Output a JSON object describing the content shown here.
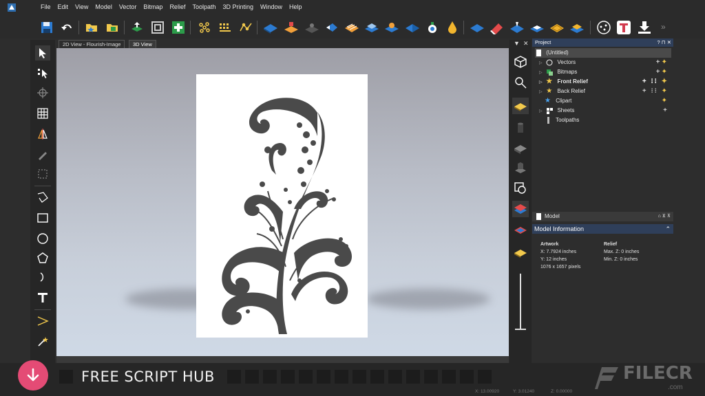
{
  "menubar": {
    "items": [
      "File",
      "Edit",
      "View",
      "Model",
      "Vector",
      "Bitmap",
      "Relief",
      "Toolpath",
      "3D Printing",
      "Window",
      "Help"
    ]
  },
  "tabs": [
    {
      "label": "2D View - Flourish-Image",
      "active": false
    },
    {
      "label": "3D View",
      "active": true
    }
  ],
  "project": {
    "title": "Project",
    "controls": "? ⊓ ✕",
    "pin": "✕",
    "root": "(Untitled)",
    "items": [
      {
        "label": "Vectors",
        "bold": false
      },
      {
        "label": "Bitmaps",
        "bold": false
      },
      {
        "label": "Front Relief",
        "bold": true
      },
      {
        "label": "Back Relief",
        "bold": false
      },
      {
        "label": "Clipart",
        "bold": false
      },
      {
        "label": "Sheets",
        "bold": false
      },
      {
        "label": "Toolpaths",
        "bold": false
      }
    ]
  },
  "model": {
    "header": "Model",
    "info_title": "Model Information",
    "artwork": {
      "heading": "Artwork",
      "x": "X: 7.7924 inches",
      "y": "Y: 12 inches",
      "pixels": "1076 x 1657 pixels"
    },
    "relief": {
      "heading": "Relief",
      "max_z": "Max. Z: 0 inches",
      "min_z": "Min. Z: 0 inches"
    }
  },
  "status": {
    "x": "X: 13.00920",
    "y": "Y: 3.01240",
    "z": "Z: 0.00000"
  },
  "watermarks": {
    "free_script_hub": "FREE SCRIPT HUB",
    "filecr": "FILECR",
    "filecr_suffix": ".com"
  },
  "colors": {
    "accent_badge": "#e44b75",
    "panel_header": "#2f3f5a",
    "flourish": "#4a4a4a"
  }
}
